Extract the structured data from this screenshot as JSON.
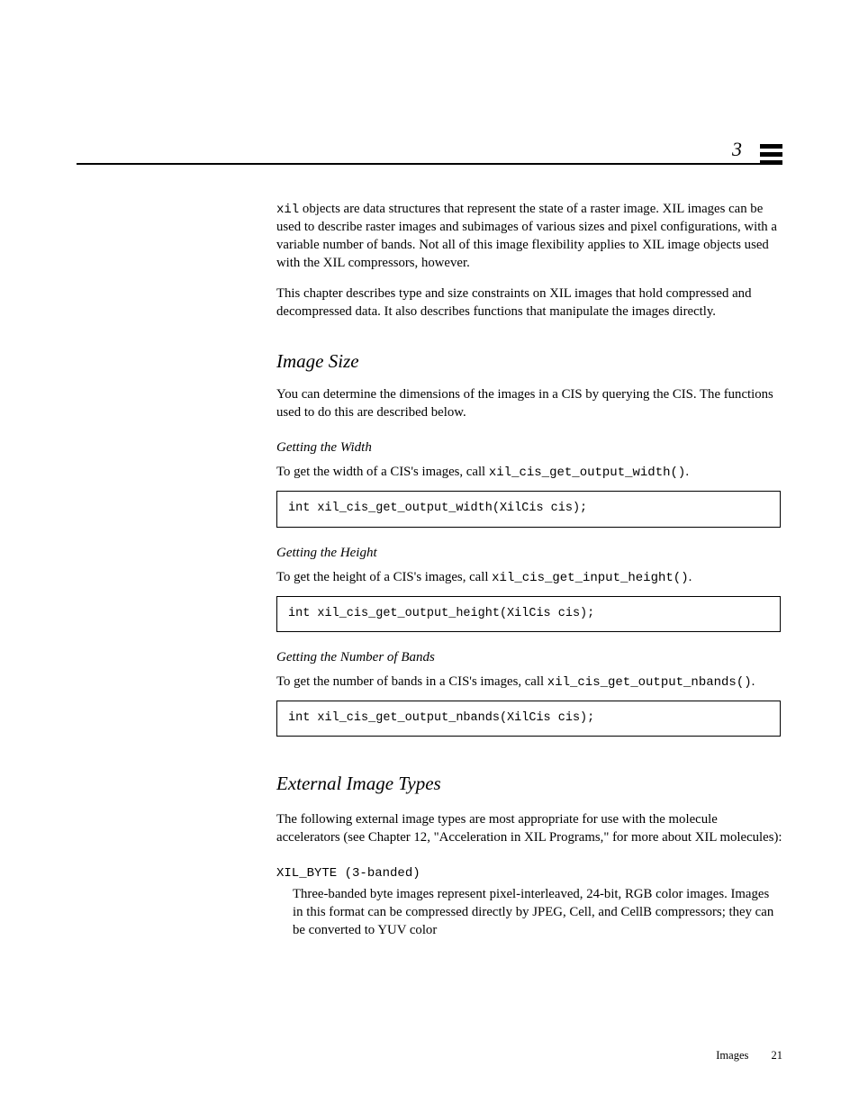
{
  "header": {
    "page_num_top": "3"
  },
  "intro": {
    "lead_label": "xil",
    "para1_rest": " objects are data structures that represent the state of a raster image. XIL images can be used to describe raster images and subimages of various sizes and pixel configurations, with a variable number of bands. Not all of this image flexibility applies to XIL image objects used with the XIL compressors, however.",
    "para2": "This chapter describes type and size constraints on XIL images that hold compressed and decompressed data. It also describes functions that manipulate the images directly."
  },
  "size": {
    "title": "Image Size",
    "para": "You can determine the dimensions of the images in a CIS by querying the CIS. The functions used to do this are described below.",
    "sub1": {
      "head": "Getting the Width",
      "lead": "To get the width of a CIS's images, call ",
      "fn": "xil_cis_get_output_width()",
      "code": "int xil_cis_get_output_width(XilCis cis);"
    },
    "sub2": {
      "head": "Getting the Height",
      "lead": "To get the height of a CIS's images, call ",
      "fn": "xil_cis_get_input_height()",
      "code": "int xil_cis_get_output_height(XilCis cis);"
    },
    "sub3": {
      "head": "Getting the Number of Bands",
      "lead": "To get the number of bands in a CIS's images, call ",
      "fn": "xil_cis_get_output_nbands()",
      "code": "int xil_cis_get_output_nbands(XilCis cis);"
    }
  },
  "ext": {
    "title": "External Image Types",
    "para1": "The following external image types are most appropriate for use with the molecule accelerators (see Chapter 12, \"Acceleration in XIL Programs,\" for more about XIL molecules):",
    "item1_head": "XIL_BYTE (3-banded)",
    "item1_body": "Three-banded byte images represent pixel-interleaved, 24-bit, RGB color images. Images in this format can be compressed directly by JPEG, Cell, and CellB compressors; they can be converted to YUV color"
  },
  "footer": {
    "text": "Images",
    "page": "21"
  }
}
